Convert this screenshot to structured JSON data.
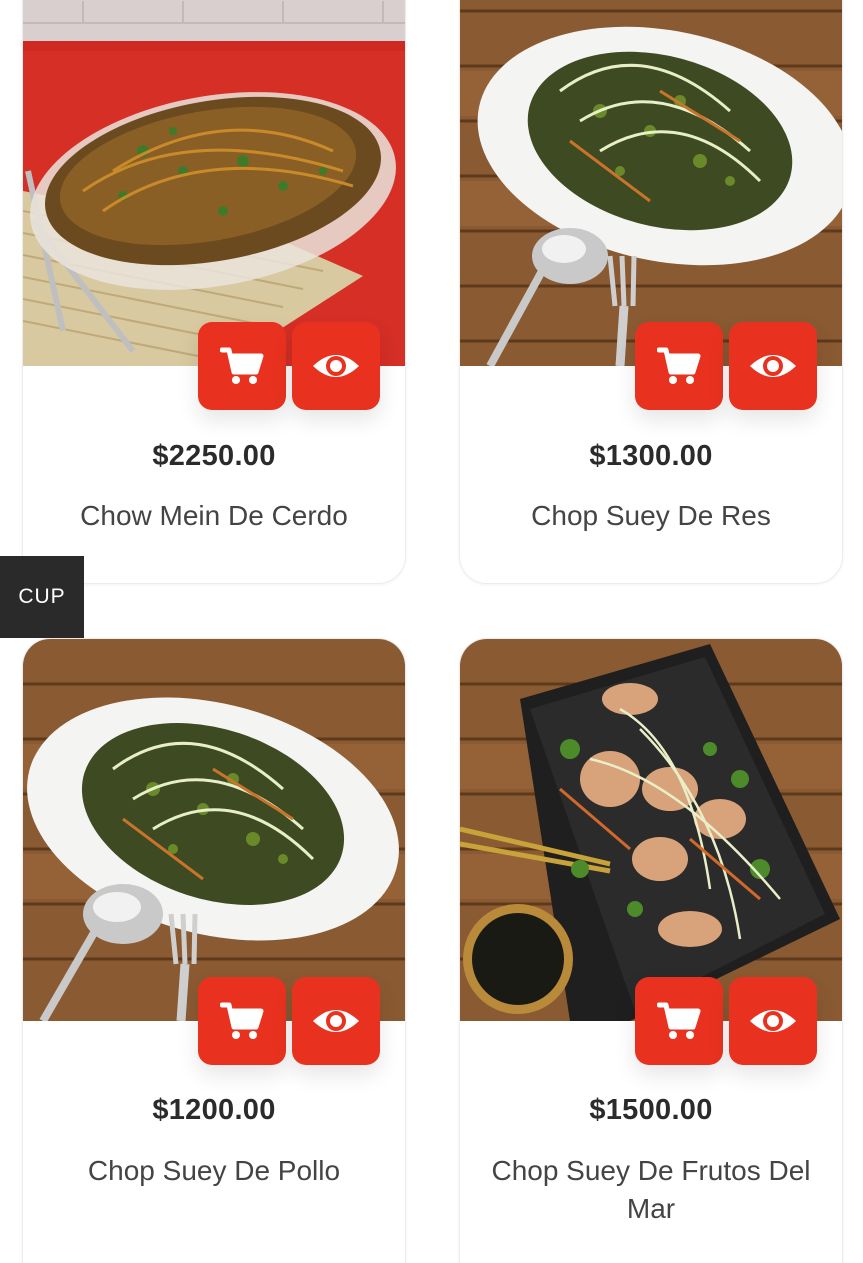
{
  "currency_tab": {
    "label": "CUP"
  },
  "colors": {
    "accent": "#e8321f",
    "price_text": "#2b2b2b",
    "name_text": "#444444",
    "currency_tab_bg": "#2a2a2a"
  },
  "products": [
    {
      "price": "$2250.00",
      "name": "Chow Mein De Cerdo",
      "cart_icon": "cart-icon",
      "view_icon": "eye-icon"
    },
    {
      "price": "$1300.00",
      "name": "Chop Suey De Res",
      "cart_icon": "cart-icon",
      "view_icon": "eye-icon"
    },
    {
      "price": "$1200.00",
      "name": "Chop Suey De Pollo",
      "cart_icon": "cart-icon",
      "view_icon": "eye-icon"
    },
    {
      "price": "$1500.00",
      "name": "Chop Suey De Frutos Del Mar",
      "cart_icon": "cart-icon",
      "view_icon": "eye-icon"
    }
  ]
}
